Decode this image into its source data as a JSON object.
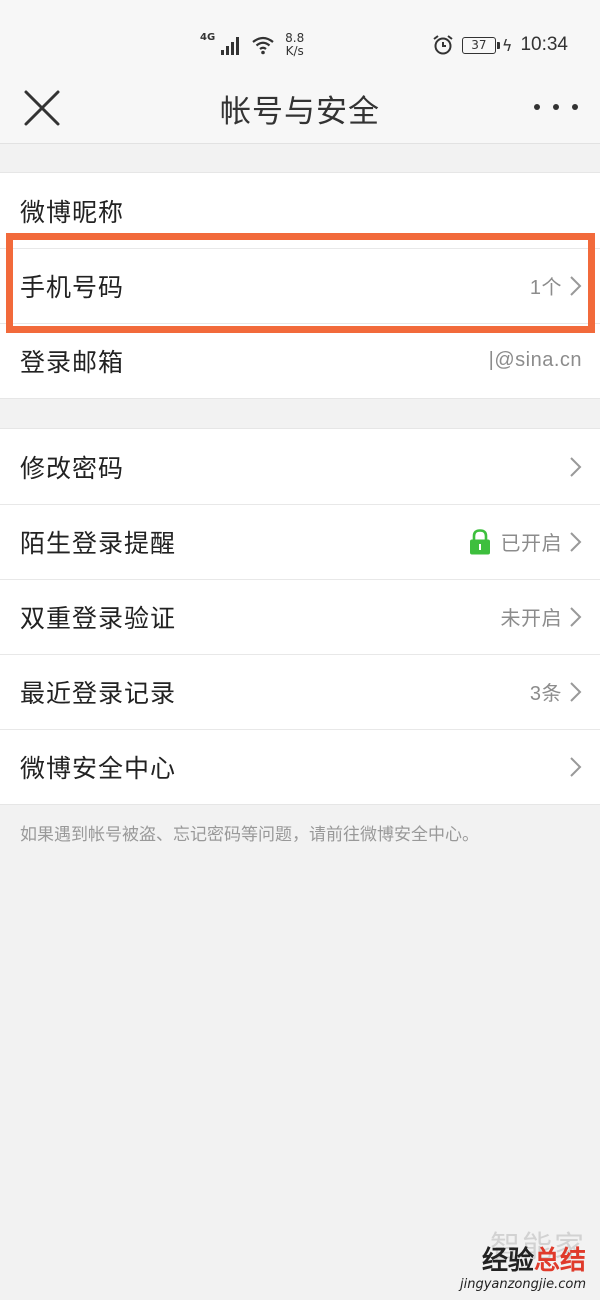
{
  "status_bar": {
    "network": "4G",
    "speed_value": "8.8",
    "speed_unit": "K/s",
    "battery": "37",
    "time": "10:34"
  },
  "header": {
    "title": "帐号与安全"
  },
  "account_group": {
    "items": [
      {
        "label": "微博昵称",
        "value": ""
      },
      {
        "label": "手机号码",
        "value": "1个"
      },
      {
        "label": "登录邮箱",
        "value": "|@sina.cn"
      }
    ]
  },
  "security_group": {
    "items": [
      {
        "label": "修改密码",
        "value": ""
      },
      {
        "label": "陌生登录提醒",
        "value": "已开启"
      },
      {
        "label": "双重登录验证",
        "value": "未开启"
      },
      {
        "label": "最近登录记录",
        "value": "3条"
      },
      {
        "label": "微博安全中心",
        "value": ""
      }
    ]
  },
  "footnote": "如果遇到帐号被盗、忘记密码等问题，请前往微博安全中心。",
  "watermark": {
    "ghost": "智能家",
    "main_prefix": "经验",
    "main_accent": "总结",
    "url": "jingyanzongjie.com"
  },
  "colors": {
    "highlight": "#f26a3b",
    "lock": "#3dbf3d",
    "background": "#f2f2f2"
  }
}
